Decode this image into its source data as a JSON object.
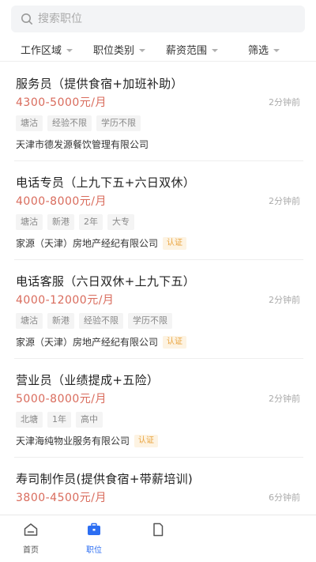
{
  "search": {
    "placeholder": "搜索职位"
  },
  "filters": [
    {
      "label": "工作区域"
    },
    {
      "label": "职位类别"
    },
    {
      "label": "薪资范围"
    },
    {
      "label": "筛选"
    }
  ],
  "jobs": [
    {
      "title": "服务员（提供食宿+加班补助）",
      "salary": "4300-5000元/月",
      "time": "2分钟前",
      "tags": [
        "塘沽",
        "经验不限",
        "学历不限"
      ],
      "company": "天津市德发源餐饮管理有限公司",
      "cert": ""
    },
    {
      "title": "电话专员（上九下五+六日双休）",
      "salary": "4000-8000元/月",
      "time": "2分钟前",
      "tags": [
        "塘沽",
        "新港",
        "2年",
        "大专"
      ],
      "company": "家源（天津）房地产经纪有限公司",
      "cert": "认证"
    },
    {
      "title": "电话客服（六日双休+上九下五）",
      "salary": "4000-12000元/月",
      "time": "2分钟前",
      "tags": [
        "塘沽",
        "新港",
        "经验不限",
        "学历不限"
      ],
      "company": "家源（天津）房地产经纪有限公司",
      "cert": "认证"
    },
    {
      "title": "营业员（业绩提成+五险）",
      "salary": "5000-8000元/月",
      "time": "2分钟前",
      "tags": [
        "北塘",
        "1年",
        "高中"
      ],
      "company": "天津海纯物业服务有限公司",
      "cert": "认证"
    },
    {
      "title": "寿司制作员(提供食宿+带薪培训)",
      "salary": "3800-4500元/月",
      "time": "6分钟前",
      "tags": [],
      "company": "",
      "cert": ""
    }
  ],
  "tabbar": [
    {
      "label": "首页",
      "icon": "home-icon",
      "active": false
    },
    {
      "label": "职位",
      "icon": "briefcase-icon",
      "active": true
    },
    {
      "label": "",
      "icon": "document-icon",
      "active": false
    }
  ],
  "colors": {
    "salary": "#d96b5c",
    "active_tab": "#2c6ef2",
    "cert": "#e9a23b"
  }
}
